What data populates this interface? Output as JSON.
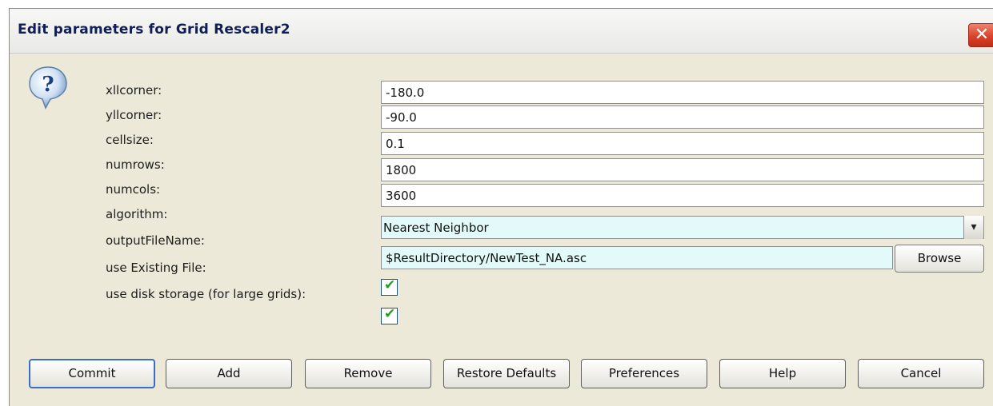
{
  "window": {
    "title": "Edit parameters for Grid Rescaler2",
    "close_symbol": "✕"
  },
  "help_icon": {
    "symbol": "?"
  },
  "params": [
    {
      "label": "xllcorner:",
      "value": "-180.0"
    },
    {
      "label": "yllcorner:",
      "value": "-90.0"
    },
    {
      "label": "cellsize:",
      "value": "0.1"
    },
    {
      "label": "numrows:",
      "value": "1800"
    },
    {
      "label": "numcols:",
      "value": "3600"
    }
  ],
  "algorithm": {
    "label": "algorithm:",
    "value": "Nearest Neighbor",
    "arrow": "▾"
  },
  "output": {
    "label": "outputFileName:",
    "value": "$ResultDirectory/NewTest_NA.asc",
    "browse_label": "Browse"
  },
  "use_existing": {
    "label": "use Existing File:",
    "checked": true,
    "check": "✔"
  },
  "disk_storage": {
    "label": "use disk storage (for large grids):",
    "checked": true,
    "check": "✔"
  },
  "buttons": {
    "commit": "Commit",
    "add": "Add",
    "remove": "Remove",
    "restore": "Restore Defaults",
    "preferences": "Preferences",
    "help": "Help",
    "cancel": "Cancel"
  },
  "colors": {
    "title": "#0f1e56",
    "dialog_bg": "#ece9d8",
    "combo_bg": "#e2fafa",
    "close_red": "#d9432a",
    "check_green": "#21a121"
  }
}
